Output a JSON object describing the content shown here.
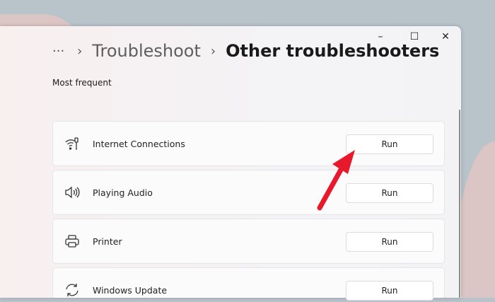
{
  "window": {
    "minimize": "–",
    "maximize": "☐",
    "close": "✕"
  },
  "breadcrumb": {
    "more": "···",
    "parent": "Troubleshoot",
    "current": "Other troubleshooters",
    "separator": "›"
  },
  "section": "Most frequent",
  "items": [
    {
      "label": "Internet Connections",
      "icon": "wifi-icon",
      "button": "Run"
    },
    {
      "label": "Playing Audio",
      "icon": "speaker-icon",
      "button": "Run"
    },
    {
      "label": "Printer",
      "icon": "printer-icon",
      "button": "Run"
    },
    {
      "label": "Windows Update",
      "icon": "refresh-icon",
      "button": "Run"
    }
  ],
  "colors": {
    "arrow": "#e8192c"
  }
}
